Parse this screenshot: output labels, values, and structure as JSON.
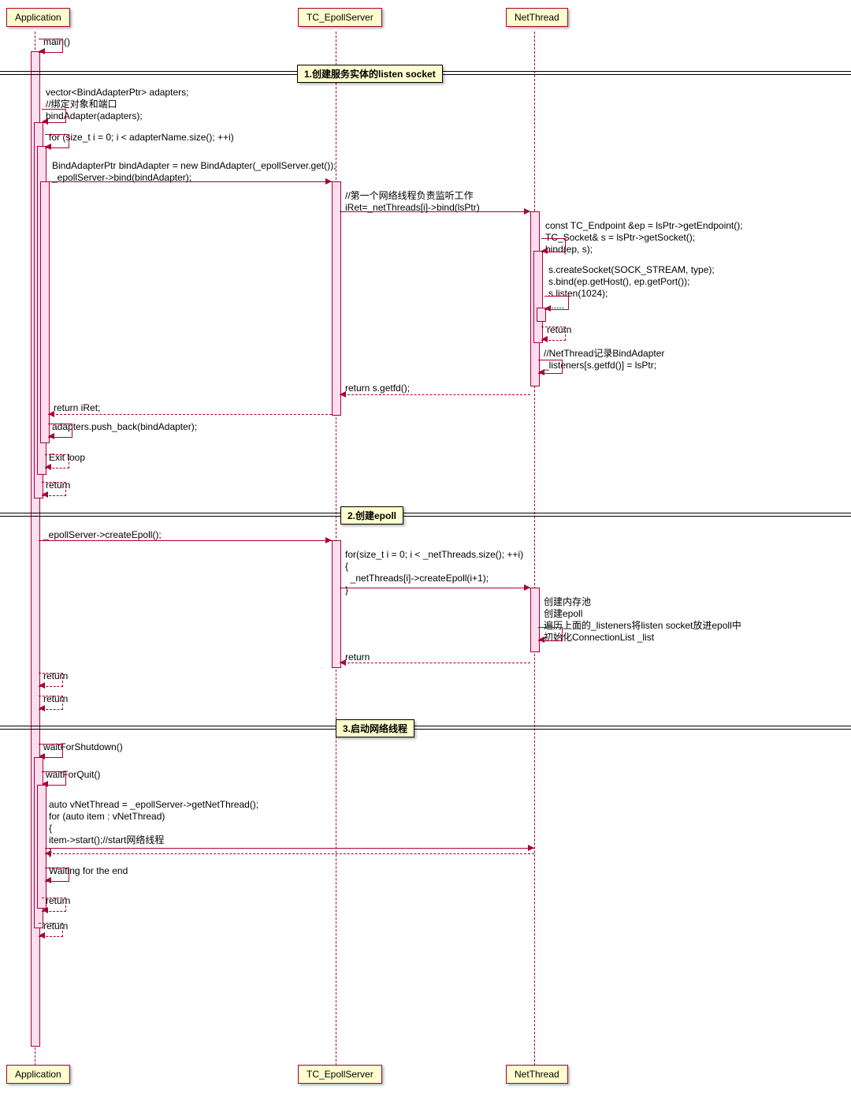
{
  "participants": {
    "p1": "Application",
    "p2": "TC_EpollServer",
    "p3": "NetThread"
  },
  "dividers": {
    "d1": "1.创建服务实体的listen socket",
    "d2": "2.创建epoll",
    "d3": "3.启动网络线程"
  },
  "m": {
    "main": "main()",
    "vec": "vector<BindAdapterPtr> adapters;\n//绑定对象和端口\nbindAdapter(adapters);",
    "for1": "for (size_t i = 0; i < adapterName.size(); ++i)",
    "bind1": "BindAdapterPtr bindAdapter = new BindAdapter(_epollServer.get());\n_epollServer->bind(bindAdapter);",
    "net1": "//第一个网络线程负责监听工作\niRet=_netThreads[i]->bind(lsPtr)",
    "ep1": "const TC_Endpoint &ep = lsPtr->getEndpoint();\nTC_Socket& s = lsPtr->getSocket();\nbind(ep, s);",
    "sock": "s.createSocket(SOCK_STREAM, type);\ns.bind(ep.getHost(), ep.getPort());\ns.listen(1024);\n......",
    "ret1": "return",
    "listen": "//NetThread记录BindAdapter\n_listeners[s.getfd()] = lsPtr;",
    "retfd": "return s.getfd();",
    "retiret": "return iRet;",
    "push": "adapters.push_back(bindAdapter);",
    "exit": "Exit loop",
    "ret2": "return",
    "create": "_epollServer->createEpoll();",
    "for2": "for(size_t i = 0; i < _netThreads.size(); ++i)\n{\n  _netThreads[i]->createEpoll(i+1);\n}",
    "pool": "创建内存池\n创建epoll\n遍历上面的_listeners将listen socket放进epoll中\n初始化ConnectionList _list",
    "ret3": "return",
    "ret4": "return",
    "ret5": "return",
    "wfs": "waitForShutdown()",
    "wfq": "waitForQuit()",
    "auto": "auto vNetThread = _epollServer->getNetThread();\nfor (auto item : vNetThread)\n{\nitem->start();//start网络线程\n}",
    "wait": "Waiting for the end",
    "ret6": "return",
    "ret7": "return"
  }
}
